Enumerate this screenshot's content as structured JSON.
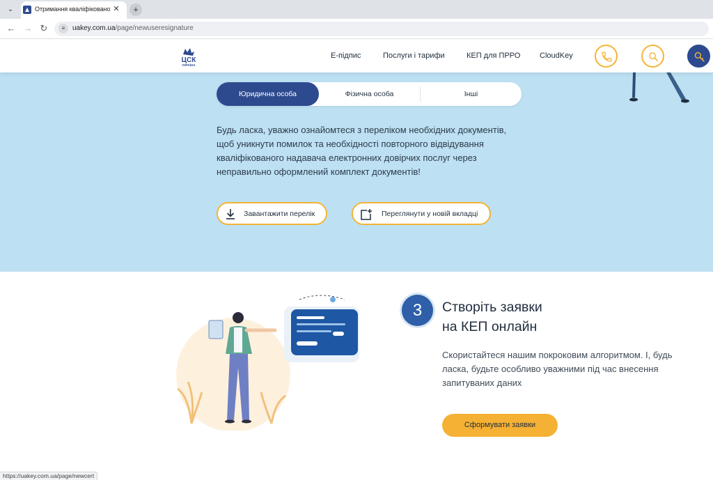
{
  "browser": {
    "tab_title": "Отримання кваліфікованого е",
    "url_host": "uakey.com.ua",
    "url_path": "/page/newuseresignature",
    "status_url": "https://uakey.com.ua/page/newcert"
  },
  "header": {
    "logo_text": "ЦСК",
    "logo_sub": "УКРАЇНА",
    "nav": [
      "Е-підпис",
      "Послуги і тарифи",
      "КЕП для ПРРО",
      "CloudKey"
    ]
  },
  "hero": {
    "tabs": [
      "Юридична особа",
      "Фізична особа",
      "Інші"
    ],
    "active_tab": 0,
    "text": "Будь ласка, уважно ознайомтеся з переліком необхідних документів, щоб уникнути помилок та необхідності повторного відвідування кваліфікованого надавача електронних довірчих послуг через неправильно оформлений комплект документів!",
    "download_label": "Завантажити перелік",
    "open_label": "Переглянути у новій вкладці"
  },
  "step": {
    "number": "3",
    "title_line1": "Створіть заявки",
    "title_line2": "на КЕП онлайн",
    "description": "Скористайтеся нашим покроковим алгоритмом. І, будь ласка, будьте особливо уважними під час внесення запитуваних даних",
    "cta_label": "Сформувати заявки"
  },
  "colors": {
    "brand_blue": "#2e4a8f",
    "hero_bg": "#bde0f2",
    "accent_yellow": "#f4b433"
  }
}
